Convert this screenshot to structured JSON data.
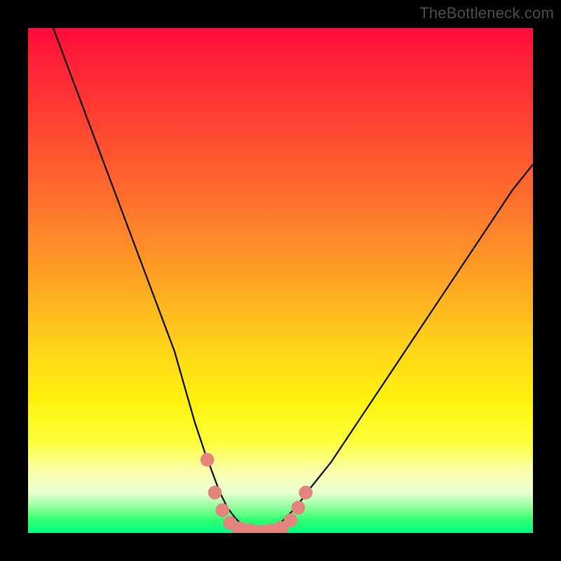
{
  "watermark": "TheBottleneck.com",
  "colors": {
    "bg": "#000000",
    "curve": "#000000",
    "markers": "#e4847e",
    "gradient_stops": [
      "#ff0a3a",
      "#ff4133",
      "#ff9028",
      "#ffd918",
      "#fcffb0",
      "#2eff6e",
      "#00ff88"
    ]
  },
  "chart_data": {
    "type": "line",
    "title": "",
    "xlabel": "",
    "ylabel": "",
    "xlim": [
      0,
      100
    ],
    "ylim": [
      0,
      100
    ],
    "curve": {
      "name": "bottleneck-curve",
      "x": [
        5,
        8,
        11,
        14,
        17,
        20,
        23,
        26,
        29,
        31,
        33,
        35,
        36.5,
        38,
        39.5,
        41,
        42.5,
        44,
        46,
        48,
        50,
        53,
        56,
        60,
        64,
        68,
        72,
        76,
        80,
        84,
        88,
        92,
        96,
        100
      ],
      "y": [
        100,
        92,
        84,
        76,
        68,
        60,
        52,
        44,
        36,
        29,
        22,
        16,
        12,
        8,
        5,
        3,
        1.5,
        0.5,
        0,
        0.5,
        2,
        5,
        9,
        14,
        20,
        26,
        32,
        38,
        44,
        50,
        56,
        62,
        68,
        73
      ]
    },
    "markers": {
      "name": "highlighted-points",
      "points": [
        {
          "x": 35.5,
          "y": 14.5,
          "r": 1.3
        },
        {
          "x": 37,
          "y": 8,
          "r": 1.3
        },
        {
          "x": 38.5,
          "y": 4.5,
          "r": 1.3
        },
        {
          "x": 40,
          "y": 2,
          "r": 1.3
        },
        {
          "x": 42,
          "y": 0.7,
          "r": 1.5
        },
        {
          "x": 44,
          "y": 0.2,
          "r": 1.6
        },
        {
          "x": 46,
          "y": 0,
          "r": 1.6
        },
        {
          "x": 48,
          "y": 0.2,
          "r": 1.6
        },
        {
          "x": 50,
          "y": 0.8,
          "r": 1.5
        },
        {
          "x": 52,
          "y": 2.5,
          "r": 1.3
        },
        {
          "x": 53.5,
          "y": 5,
          "r": 1.3
        },
        {
          "x": 55,
          "y": 8,
          "r": 1.3
        }
      ]
    }
  }
}
